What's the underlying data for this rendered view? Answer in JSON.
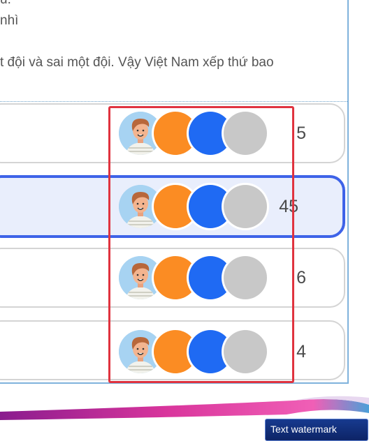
{
  "question": {
    "line1": "u.",
    "line2": "nhì",
    "line3": "t đội và sai một đội. Vậy Việt Nam xếp thứ bao"
  },
  "options": [
    {
      "count": "5",
      "selected": false
    },
    {
      "count": "45",
      "selected": true
    },
    {
      "count": "6",
      "selected": false
    },
    {
      "count": "4",
      "selected": false
    }
  ],
  "watermark": {
    "label": "Text watermark"
  },
  "colors": {
    "accent": "#3e63e8",
    "orange": "#fb8c23",
    "blue": "#1f6af3",
    "gray": "#c8c8c8",
    "highlight": "#e0333f"
  }
}
